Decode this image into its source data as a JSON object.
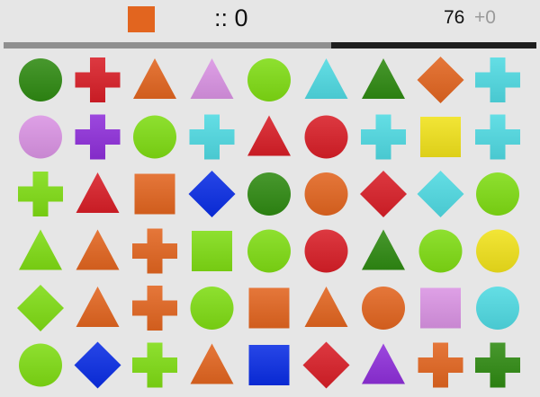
{
  "colors": {
    "darkgreen": "#2f8a12",
    "lime": "#7fdc14",
    "red": "#d81e27",
    "orange": "#e2651f",
    "pink": "#d993e3",
    "cyan": "#4fd9e2",
    "purple": "#8e2fd9",
    "yellow": "#f0e11b",
    "blue": "#0a2de4"
  },
  "hud": {
    "target_color": "orange",
    "score_text": ":: 0",
    "moves_left": "76",
    "bonus_text": "+0",
    "progress_fraction": 0.615
  },
  "grid": {
    "rows": 6,
    "cols": 9,
    "cells": [
      [
        [
          "circle",
          "darkgreen"
        ],
        [
          "cross",
          "red"
        ],
        [
          "triangle",
          "orange"
        ],
        [
          "triangle",
          "pink"
        ],
        [
          "circle",
          "lime"
        ],
        [
          "triangle",
          "cyan"
        ],
        [
          "triangle",
          "darkgreen"
        ],
        [
          "diamond",
          "orange"
        ],
        [
          "cross",
          "cyan"
        ]
      ],
      [
        [
          "circle",
          "pink"
        ],
        [
          "cross",
          "purple"
        ],
        [
          "circle",
          "lime"
        ],
        [
          "cross",
          "cyan"
        ],
        [
          "triangle",
          "red"
        ],
        [
          "circle",
          "red"
        ],
        [
          "cross",
          "cyan"
        ],
        [
          "square",
          "yellow"
        ],
        [
          "cross",
          "cyan"
        ]
      ],
      [
        [
          "cross",
          "lime"
        ],
        [
          "triangle",
          "red"
        ],
        [
          "square",
          "orange"
        ],
        [
          "diamond",
          "blue"
        ],
        [
          "circle",
          "darkgreen"
        ],
        [
          "circle",
          "orange"
        ],
        [
          "diamond",
          "red"
        ],
        [
          "diamond",
          "cyan"
        ],
        [
          "circle",
          "lime"
        ]
      ],
      [
        [
          "triangle",
          "lime"
        ],
        [
          "triangle",
          "orange"
        ],
        [
          "cross",
          "orange"
        ],
        [
          "square",
          "lime"
        ],
        [
          "circle",
          "lime"
        ],
        [
          "circle",
          "red"
        ],
        [
          "triangle",
          "darkgreen"
        ],
        [
          "circle",
          "lime"
        ],
        [
          "circle",
          "yellow"
        ]
      ],
      [
        [
          "diamond",
          "lime"
        ],
        [
          "triangle",
          "orange"
        ],
        [
          "cross",
          "orange"
        ],
        [
          "circle",
          "lime"
        ],
        [
          "square",
          "orange"
        ],
        [
          "triangle",
          "orange"
        ],
        [
          "circle",
          "orange"
        ],
        [
          "square",
          "pink"
        ],
        [
          "circle",
          "cyan"
        ]
      ],
      [
        [
          "circle",
          "lime"
        ],
        [
          "diamond",
          "blue"
        ],
        [
          "cross",
          "lime"
        ],
        [
          "triangle",
          "orange"
        ],
        [
          "square",
          "blue"
        ],
        [
          "diamond",
          "red"
        ],
        [
          "triangle",
          "purple"
        ],
        [
          "cross",
          "orange"
        ],
        [
          "cross",
          "darkgreen"
        ]
      ]
    ]
  }
}
